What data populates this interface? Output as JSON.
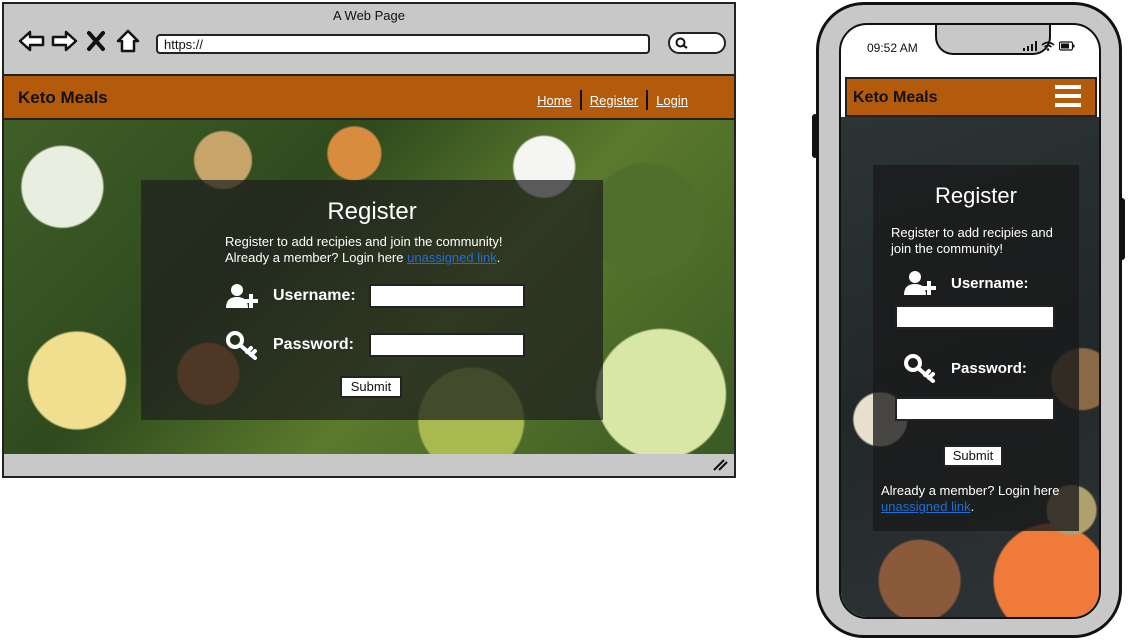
{
  "desktop": {
    "window_title": "A Web Page",
    "url": "https://",
    "brand": "Keto Meals",
    "nav": [
      {
        "label": "Home"
      },
      {
        "label": "Register"
      },
      {
        "label": "Login"
      }
    ],
    "form": {
      "title": "Register",
      "intro_line1": "Register to add recipies and join the community!",
      "intro_line2": "Already a member? Login here",
      "link_text": "unassigned link",
      "after_link": ".",
      "username_label": "Username:",
      "password_label": "Password:",
      "submit_label": "Submit"
    }
  },
  "mobile": {
    "time": "09:52 AM",
    "brand": "Keto Meals",
    "form": {
      "title": "Register",
      "intro": "Register to add recipies and join the community!",
      "username_label": "Username:",
      "password_label": "Password:",
      "submit_label": "Submit",
      "footer_text": "Already a member? Login here",
      "link_text": "unassigned link",
      "after_link": "."
    }
  },
  "colors": {
    "header": "#b35b0a",
    "link": "#1f6fd6",
    "panel": "rgba(30,30,30,0.72)"
  },
  "icons": [
    "back-arrow-icon",
    "forward-arrow-icon",
    "close-icon",
    "home-icon",
    "search-icon",
    "add-user-icon",
    "key-icon",
    "menu-icon",
    "signal-icon",
    "wifi-icon",
    "battery-icon",
    "resize-grip-icon"
  ]
}
